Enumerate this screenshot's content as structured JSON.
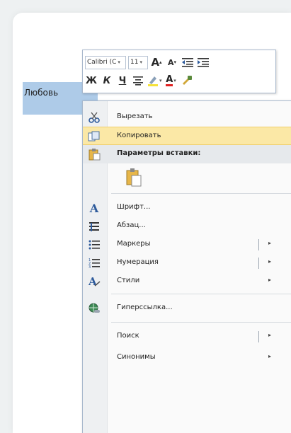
{
  "document": {
    "selected_text": "Любовь"
  },
  "toolbar": {
    "font_name": "Calibri (С",
    "font_size": "11",
    "grow_font": "A",
    "shrink_font": "A",
    "bold": "Ж",
    "italic": "К",
    "underline": "Ч"
  },
  "menu": {
    "items": [
      {
        "label": "Вырезать",
        "icon": "scissors-icon"
      },
      {
        "label": "Копировать",
        "icon": "copy-icon",
        "highlighted": true
      },
      {
        "label": "Параметры вставки:",
        "icon": "paste-icon",
        "header": true
      },
      {
        "label": "Шрифт...",
        "icon": "font-icon"
      },
      {
        "label": "Абзац...",
        "icon": "paragraph-icon"
      },
      {
        "label": "Маркеры",
        "icon": "bullets-icon",
        "submenu": true
      },
      {
        "label": "Нумерация",
        "icon": "numbering-icon",
        "submenu": true
      },
      {
        "label": "Стили",
        "icon": "styles-icon",
        "submenu": true
      },
      {
        "label": "Гиперссылка...",
        "icon": "hyperlink-icon"
      },
      {
        "label": "Поиск",
        "icon": "",
        "submenu": true
      },
      {
        "label": "Синонимы",
        "icon": "",
        "submenu": true
      }
    ],
    "submenu_arrow": "▸"
  }
}
